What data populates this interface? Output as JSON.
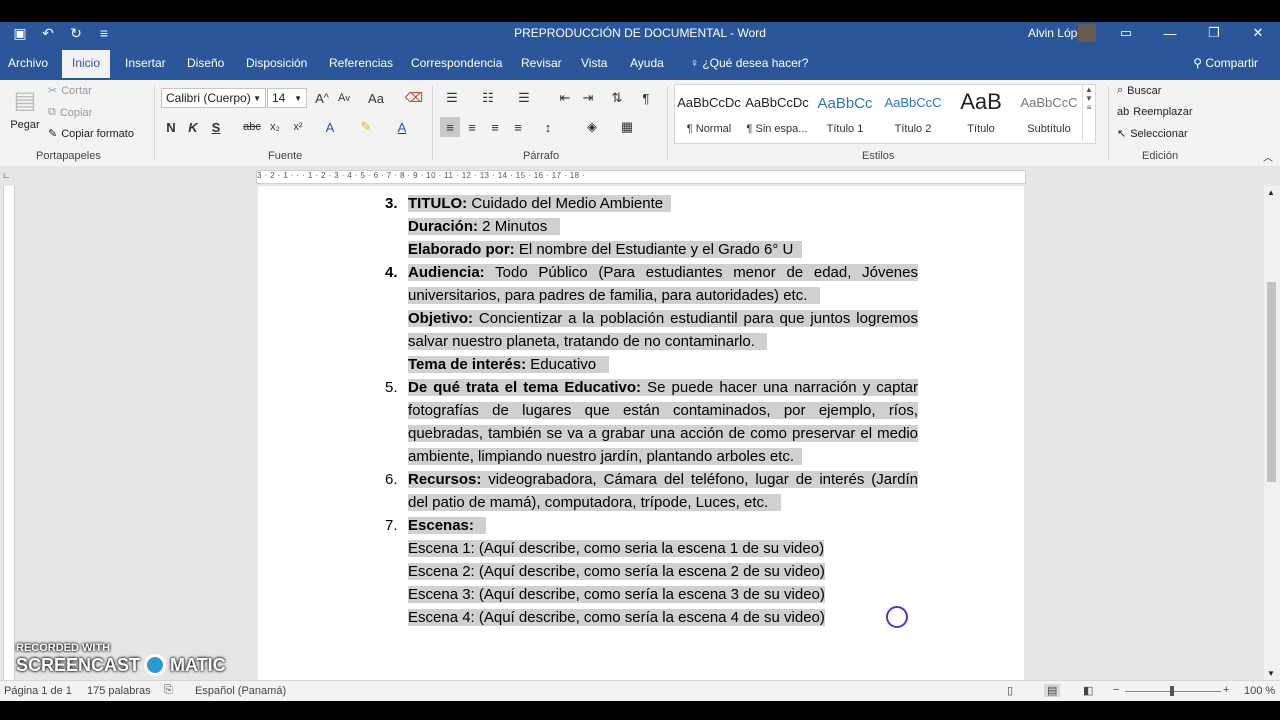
{
  "window": {
    "title": "PREPRODUCCIÓN DE DOCUMENTAL  -  Word",
    "user": "Alvin López"
  },
  "tabs": [
    "Archivo",
    "Inicio",
    "Insertar",
    "Diseño",
    "Disposición",
    "Referencias",
    "Correspondencia",
    "Revisar",
    "Vista",
    "Ayuda"
  ],
  "tell_me": "¿Qué desea hacer?",
  "share": "Compartir",
  "clipboard": {
    "paste": "Pegar",
    "cut": "Cortar",
    "copy": "Copiar",
    "format_painter": "Copiar formato",
    "label": "Portapapeles"
  },
  "font": {
    "name": "Calibri (Cuerpo)",
    "size": "14",
    "bold": "N",
    "italic": "K",
    "underline": "S",
    "strike": "abc",
    "sub": "x₂",
    "sup": "x²",
    "case": "Aa",
    "label": "Fuente"
  },
  "paragraph": {
    "label": "Párrafo"
  },
  "styles": {
    "label": "Estilos",
    "items": [
      {
        "preview": "AaBbCcDc",
        "name": "¶ Normal"
      },
      {
        "preview": "AaBbCcDc",
        "name": "¶ Sin espa..."
      },
      {
        "preview": "AaBbCc",
        "name": "Título 1"
      },
      {
        "preview": "AaBbCcC",
        "name": "Título 2"
      },
      {
        "preview": "AaB",
        "name": "Título"
      },
      {
        "preview": "AaBbCcC",
        "name": "Subtítulo"
      }
    ]
  },
  "editing": {
    "find": "Buscar",
    "replace": "Reemplazar",
    "select": "Seleccionar",
    "label": "Edición"
  },
  "ruler": "3 · 2 · 1 · · · 1 · 2 · 3 · 4 · 5 · 6 · 7 · 8 · 9 · 10 · 11 · 12 · 13 · 14 · 15 · 16 · 17 · 18 ·",
  "document": {
    "item3_num": "3.",
    "item3_label": "TITULO:",
    "item3_text": " Cuidado del Medio Ambiente",
    "duration_label": "Duración:",
    "duration_text": " 2 Minutos",
    "author_label": "Elaborado por:",
    "author_text": " El nombre del Estudiante y el Grado 6° U",
    "item4_num": "4.",
    "item4_label": "Audiencia:",
    "item4_text": " Todo Público (Para estudiantes menor de edad, Jóvenes universitarios, para padres de familia, para autoridades) etc.",
    "objective_label": "Objetivo:",
    "objective_text": " Concientizar a la población estudiantil para que juntos logremos salvar nuestro planeta, tratando de no contaminarlo.",
    "topic_label": "Tema de interés:",
    "topic_text": " Educativo",
    "item5_num": "5.",
    "item5_label": "De qué trata el tema Educativo:",
    "item5_text": " Se puede hacer una narración y captar fotografías de lugares que están contaminados, por ejemplo, ríos, quebradas, también se va a grabar una acción de como preservar el medio ambiente, limpiando nuestro jardín, plantando arboles etc.",
    "item6_num": "6.",
    "item6_label": "Recursos:",
    "item6_text": " videograbadora, Cámara del teléfono, lugar de interés (Jardín del patio de mamá), computadora, trípode, Luces, etc.",
    "item7_num": "7.",
    "item7_label": "Escenas:",
    "scenes": [
      "Escena 1: (Aquí describe, como seria la escena 1 de su video)",
      "Escena 2: (Aquí describe, como sería la escena 2 de su video)",
      "Escena 3: (Aquí describe, como sería la escena 3 de su video)",
      "Escena 4: (Aquí describe, como sería la escena 4 de su video)"
    ]
  },
  "status": {
    "page": "Página 1 de 1",
    "words": "175 palabras",
    "language": "Español (Panamá)",
    "zoom": "100 %"
  },
  "watermark": {
    "line1": "RECORDED WITH",
    "line2": "SCREENCAST",
    "line3": "MATIC"
  }
}
